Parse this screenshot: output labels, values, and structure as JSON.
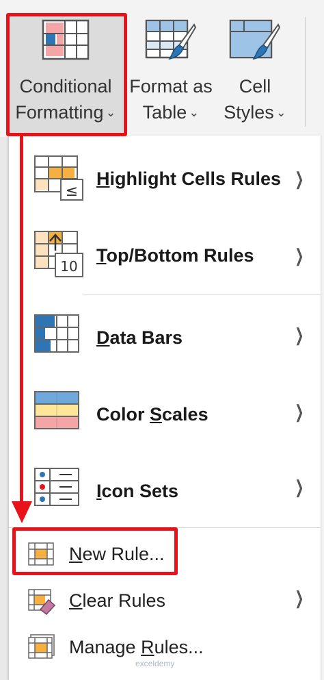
{
  "ribbon": {
    "conditional_formatting": {
      "line1": "Conditional",
      "line2": "Formatting",
      "icon": "conditional-formatting-icon"
    },
    "format_as_table": {
      "line1": "Format as",
      "line2": "Table",
      "icon": "format-as-table-icon"
    },
    "cell_styles": {
      "line1": "Cell",
      "line2": "Styles",
      "icon": "cell-styles-icon"
    },
    "chevron": "⌄"
  },
  "menu": {
    "items": [
      {
        "label": "Highlight Cells Rules",
        "accel": "H",
        "rest": "ighlight Cells Rules",
        "icon": "highlight-cells-icon",
        "submenu": true
      },
      {
        "label": "Top/Bottom Rules",
        "accel": "T",
        "rest": "op/Bottom Rules",
        "icon": "top-bottom-icon",
        "submenu": true
      },
      {
        "label": "Data Bars",
        "accel": "D",
        "rest": "ata Bars",
        "icon": "data-bars-icon",
        "submenu": true
      },
      {
        "label": "Color Scales",
        "pre": "Color ",
        "accel": "S",
        "rest": "cales",
        "icon": "color-scales-icon",
        "submenu": true
      },
      {
        "label": "Icon Sets",
        "accel": "I",
        "rest": "con Sets",
        "icon": "icon-sets-icon",
        "submenu": true
      },
      {
        "label": "New Rule...",
        "accel": "N",
        "rest": "ew Rule...",
        "icon": "new-rule-icon",
        "submenu": false
      },
      {
        "label": "Clear Rules",
        "accel": "C",
        "rest": "lear Rules",
        "icon": "clear-rules-icon",
        "submenu": true
      },
      {
        "label": "Manage Rules...",
        "pre": "Manage ",
        "accel": "R",
        "rest": "ules...",
        "icon": "manage-rules-icon",
        "submenu": false
      }
    ],
    "submenu_arrow": "❯",
    "top_bottom_badge": "10",
    "highlight_badge": "≤"
  },
  "watermark": "exceldemy",
  "colors": {
    "highlight": "#e8121a",
    "accent_blue": "#2e75b6",
    "light_blue": "#9dc3e6",
    "pink": "#f4a6a6",
    "orange": "#f5b041",
    "yellow": "#ffe699"
  }
}
